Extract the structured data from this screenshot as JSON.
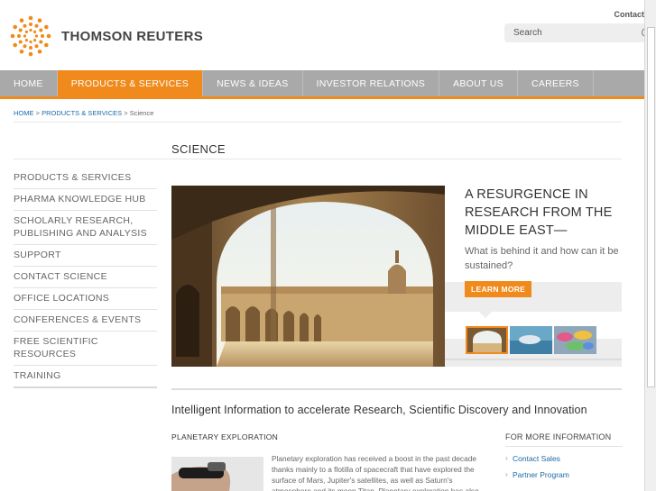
{
  "header": {
    "logo_text": "THOMSON REUTERS",
    "contact_label": "Contact",
    "search_placeholder": "Search"
  },
  "nav": {
    "items": [
      {
        "label": "HOME"
      },
      {
        "label": "PRODUCTS & SERVICES"
      },
      {
        "label": "NEWS & IDEAS"
      },
      {
        "label": "INVESTOR RELATIONS"
      },
      {
        "label": "ABOUT US"
      },
      {
        "label": "CAREERS"
      }
    ],
    "active_index": 1
  },
  "breadcrumb": {
    "home": "HOME",
    "sep1": ">",
    "products": "PRODUCTS & SERVICES",
    "sep2": ">",
    "current": "Science"
  },
  "page_title": "SCIENCE",
  "sidebar": {
    "items": [
      {
        "label": "PRODUCTS & SERVICES"
      },
      {
        "label": "PHARMA KNOWLEDGE HUB"
      },
      {
        "label": "SCHOLARLY RESEARCH, PUBLISHING AND ANALYSIS"
      },
      {
        "label": "SUPPORT"
      },
      {
        "label": "CONTACT SCIENCE"
      },
      {
        "label": "OFFICE LOCATIONS"
      },
      {
        "label": "CONFERENCES & EVENTS"
      },
      {
        "label": "FREE SCIENTIFIC RESOURCES"
      },
      {
        "label": "TRAINING"
      }
    ]
  },
  "hero": {
    "heading": "A RESURGENCE IN RESEARCH FROM THE MIDDLE EAST—",
    "subtext": "What is behind it and how can it be sustained?",
    "button_label": "LEARN MORE"
  },
  "tagline": "Intelligent Information to accelerate Research, Scientific Discovery and Innovation",
  "feature": {
    "title": "PLANETARY EXPLORATION",
    "text": "Planetary exploration has received a boost in the past decade thanks mainly to a flotilla of spacecraft that have explored the surface of Mars, Jupiter's satellites, as well as Saturn's atmosphere and its moon Titan. Planetary exploration has also"
  },
  "more_info": {
    "title": "FOR MORE INFORMATION",
    "links": [
      {
        "label": "Contact Sales"
      },
      {
        "label": "Partner Program"
      }
    ]
  },
  "colors": {
    "accent": "#f08a1c",
    "nav_bg": "#a9a9a9",
    "link": "#1a6aa8"
  }
}
